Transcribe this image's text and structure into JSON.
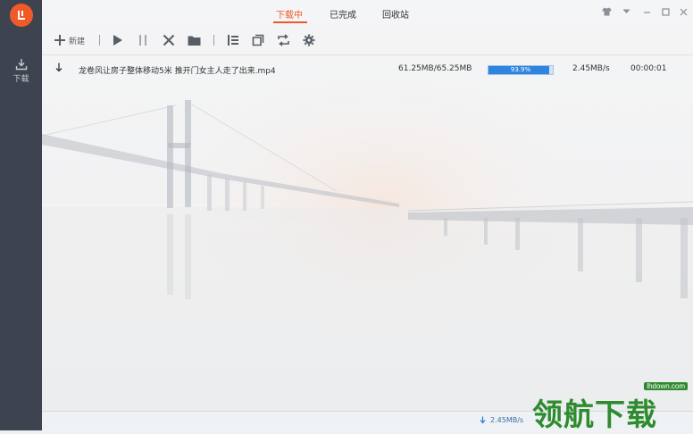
{
  "sidebar": {
    "items": [
      {
        "label": "下载"
      }
    ]
  },
  "tabs": [
    {
      "label": "下载中",
      "active": true
    },
    {
      "label": "已完成",
      "active": false
    },
    {
      "label": "回收站",
      "active": false
    }
  ],
  "toolbar": {
    "new_label": "新建"
  },
  "downloads": [
    {
      "name": "龙卷风让房子整体移动5米 推开门女主人走了出来.mp4",
      "size": "61.25MB/65.25MB",
      "progress_text": "93.9%",
      "progress": 0.939,
      "speed": "2.45MB/s",
      "remaining": "00:00:01"
    }
  ],
  "statusbar": {
    "speed": "2.45MB/s"
  },
  "watermark": {
    "brand": "领航下载",
    "url": "lhdown.com"
  },
  "colors": {
    "accent": "#f05a28",
    "progress": "#2f84e0",
    "sidebar": "#3d4450"
  }
}
